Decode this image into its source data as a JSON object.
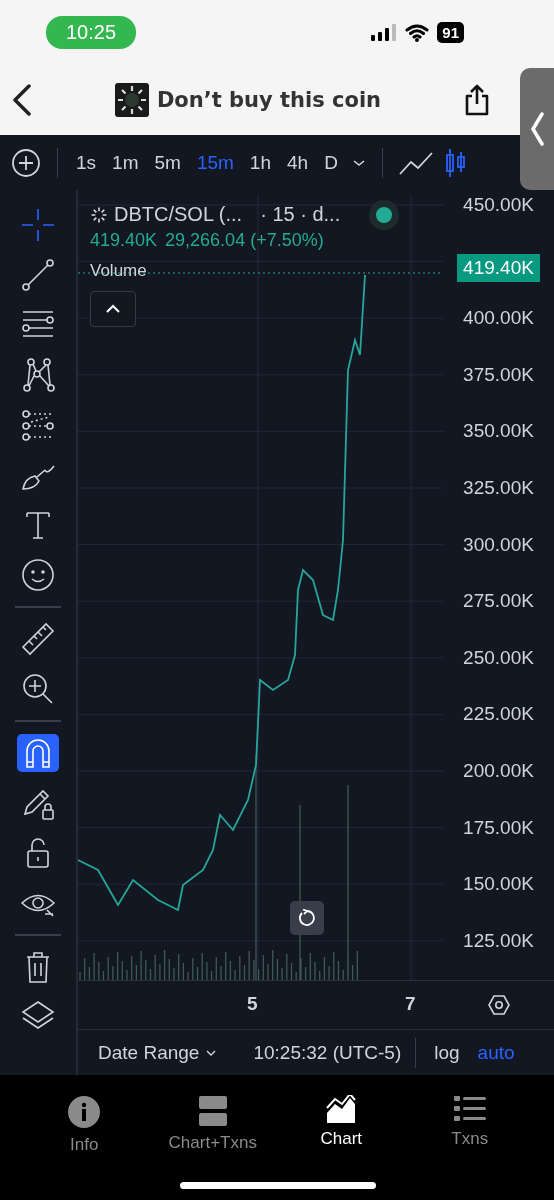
{
  "status_bar": {
    "time": "10:25",
    "battery": "91"
  },
  "header": {
    "title": "Don’t buy this coin"
  },
  "timeframes": [
    {
      "label": "1s",
      "selected": false
    },
    {
      "label": "1m",
      "selected": false
    },
    {
      "label": "5m",
      "selected": false
    },
    {
      "label": "15m",
      "selected": true
    },
    {
      "label": "1h",
      "selected": false
    },
    {
      "label": "4h",
      "selected": false
    },
    {
      "label": "D",
      "selected": false
    }
  ],
  "chart_types": [
    {
      "kind": "line",
      "selected": false
    },
    {
      "kind": "candles",
      "selected": true
    }
  ],
  "tool_groups": [
    {
      "tools": [
        {
          "kind": "crosshair",
          "selected": true
        },
        {
          "kind": "trend-line",
          "selected": false
        },
        {
          "kind": "parallel-lines",
          "selected": false
        },
        {
          "kind": "pattern",
          "selected": false
        },
        {
          "kind": "fib",
          "selected": false
        },
        {
          "kind": "brush",
          "selected": false
        },
        {
          "kind": "text",
          "selected": false
        },
        {
          "kind": "smiley",
          "selected": false
        }
      ]
    },
    {
      "tools": [
        {
          "kind": "ruler",
          "selected": false
        },
        {
          "kind": "zoom",
          "selected": false
        }
      ]
    },
    {
      "tools": [
        {
          "kind": "magnet",
          "selected": true
        },
        {
          "kind": "pencil-lock",
          "selected": false
        },
        {
          "kind": "lock",
          "selected": false
        },
        {
          "kind": "eye",
          "selected": false
        }
      ]
    },
    {
      "tools": [
        {
          "kind": "trash",
          "selected": false
        },
        {
          "kind": "layers",
          "selected": false
        }
      ]
    }
  ],
  "chart": {
    "symbol": "DBTC/SOL (...",
    "interval": "· 15 · d...",
    "live": true,
    "price": "419.40K",
    "change": "29,266.04 (+7.50%)",
    "volume_label": "Volume",
    "price_tag": "419.40K",
    "y_labels": [
      "450.00K",
      "400.00K",
      "375.00K",
      "350.00K",
      "325.00K",
      "300.00K",
      "275.00K",
      "250.00K",
      "225.00K",
      "200.00K",
      "175.00K",
      "150.00K",
      "125.00K"
    ],
    "x_labels": [
      "5",
      "7"
    ]
  },
  "footer": {
    "date_range": "Date Range",
    "time": "10:25:32 (UTC-5)",
    "scales": [
      {
        "label": "log",
        "on": false
      },
      {
        "label": "auto",
        "on": true
      }
    ]
  },
  "tabs": [
    {
      "label": "Info",
      "kind": "info",
      "selected": false
    },
    {
      "label": "Chart+Txns",
      "kind": "split",
      "selected": false
    },
    {
      "label": "Chart",
      "kind": "chart",
      "selected": true
    },
    {
      "label": "Txns",
      "kind": "list",
      "selected": false
    }
  ]
}
